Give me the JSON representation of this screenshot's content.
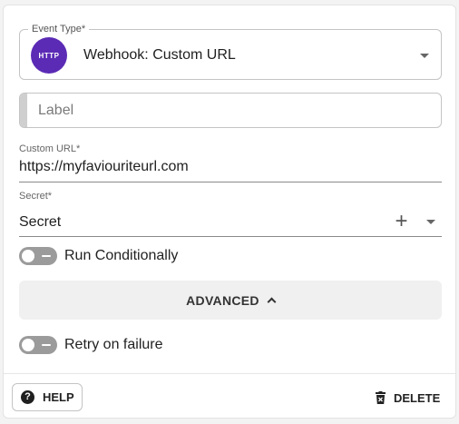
{
  "event_type": {
    "label": "Event Type*",
    "badge": "HTTP",
    "value": "Webhook: Custom URL"
  },
  "label_field": {
    "placeholder": "Label",
    "value": ""
  },
  "custom_url": {
    "label": "Custom URL*",
    "value": "https://myfaviouriteurl.com"
  },
  "secret": {
    "label": "Secret*",
    "value": "Secret",
    "add_icon": "plus-icon"
  },
  "run_conditionally": {
    "label": "Run Conditionally",
    "enabled": false
  },
  "advanced": {
    "label": "ADVANCED",
    "expanded": true
  },
  "retry_on_failure": {
    "label": "Retry on failure",
    "enabled": false
  },
  "footer": {
    "help_label": "HELP",
    "delete_label": "DELETE"
  },
  "colors": {
    "badge_purple": "#5b2bb5",
    "toggle_off": "#9b9b9b",
    "advanced_bg": "#f0f0f0"
  }
}
